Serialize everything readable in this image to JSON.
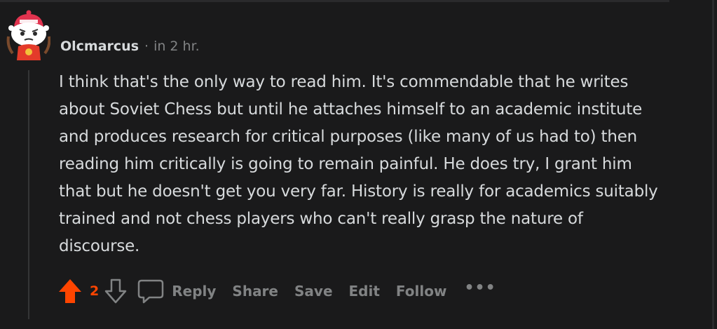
{
  "comment": {
    "author": "Olcmarcus",
    "separator": "·",
    "timestamp": "in 2 hr.",
    "body": "I think that's the only way to read him. It's commendable that he writes about Soviet Chess but until he attaches himself to an academic institute and produces research for critical purposes (like many of us had to) then reading him critically is going to remain painful. He does try, I grant him that but he doesn't get you very far. History is really for academics suitably trained and not chess players who can't really grasp the nature of discourse.",
    "score": "2"
  },
  "actions": {
    "reply": "Reply",
    "share": "Share",
    "save": "Save",
    "edit": "Edit",
    "follow": "Follow",
    "more": "•••"
  },
  "icons": {
    "avatar": "snoo-avatar-icon",
    "upvote": "upvote-arrow-icon",
    "downvote": "downvote-arrow-icon",
    "reply": "speech-bubble-icon"
  },
  "colors": {
    "background": "#1a1a1b",
    "upvoted": "#ff4500",
    "text": "#d7dadc",
    "muted": "#818384"
  }
}
